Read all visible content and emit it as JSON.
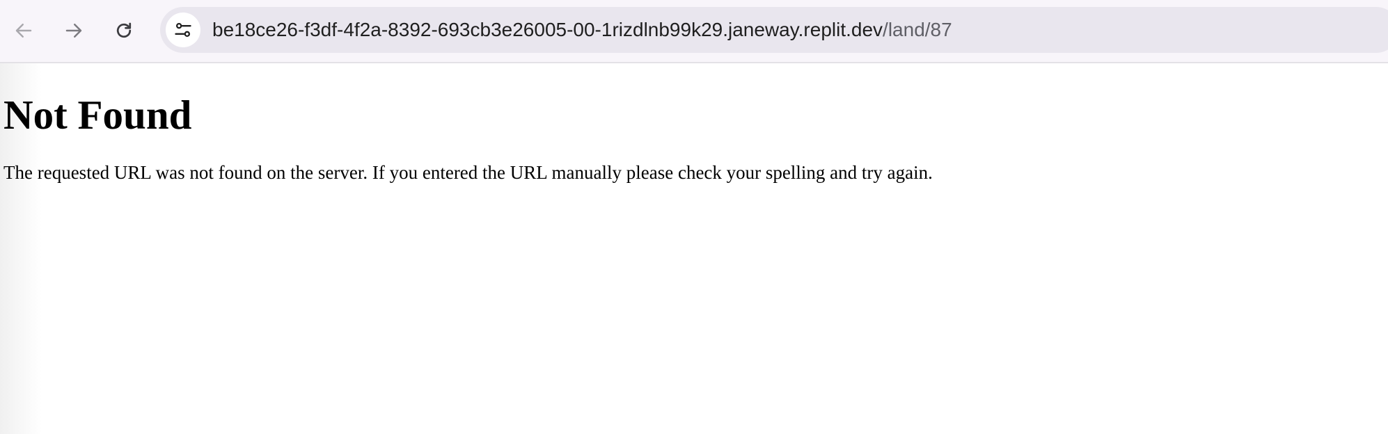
{
  "browser": {
    "back_icon": "arrow-left-icon",
    "forward_icon": "arrow-right-icon",
    "reload_icon": "reload-icon",
    "site_info_icon": "tune-icon",
    "url_host": "be18ce26-f3df-4f2a-8392-693cb3e26005-00-1rizdlnb99k29.janeway.replit.dev",
    "url_path": "/land/87"
  },
  "page": {
    "title": "Not Found",
    "message": "The requested URL was not found on the server. If you entered the URL manually please check your spelling and try again."
  },
  "colors": {
    "toolbar_bg": "#f8f5fa",
    "address_bar_bg": "#e9e6ee",
    "text": "#000000",
    "url_path": "#5f5f66"
  }
}
